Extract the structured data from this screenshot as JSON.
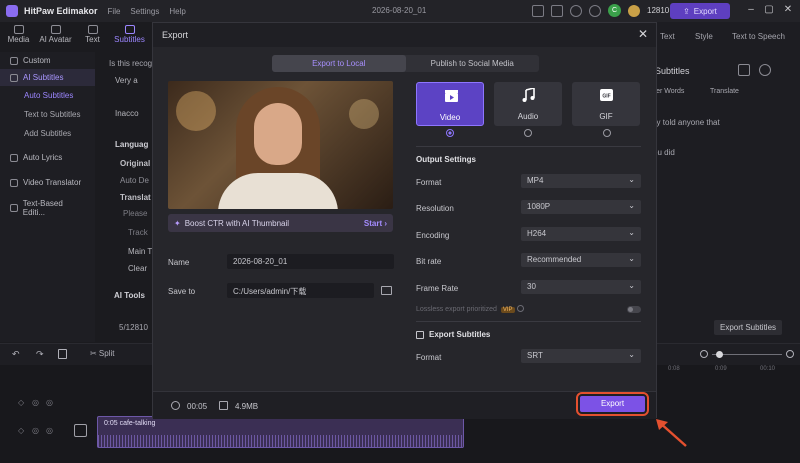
{
  "titlebar": {
    "app_title": "HitPaw Edimakor",
    "menus": [
      "File",
      "Settings",
      "Help"
    ],
    "project_name": "2026-08-20_01",
    "avatar_letter": "C",
    "credits": "12810",
    "export_label": "Export"
  },
  "tool_tabs": [
    {
      "label": "Media",
      "icon": "media-icon"
    },
    {
      "label": "AI Avatar",
      "icon": "avatar-icon"
    },
    {
      "label": "Text",
      "icon": "text-icon"
    },
    {
      "label": "Subtitles",
      "icon": "subtitles-icon"
    }
  ],
  "sidebar": {
    "items": [
      {
        "label": "Custom"
      },
      {
        "label": "AI Subtitles"
      },
      {
        "label": "Auto Subtitles"
      },
      {
        "label": "Text to Subtitles"
      },
      {
        "label": "Add Subtitles"
      },
      {
        "label": "Auto Lyrics"
      },
      {
        "label": "Video Translator"
      },
      {
        "label": "Text-Based Editi..."
      }
    ]
  },
  "mid_panel": {
    "question": "Is this recog",
    "very": "Very a",
    "inacc": "Inacco",
    "language": "Languag",
    "original": "Original",
    "auto": "Auto De",
    "translate": "Translat",
    "please": "Please",
    "track": "Track",
    "main": "Main T",
    "clear": "Clear",
    "ai_tools": "AI Tools",
    "credits_row": "5/12810"
  },
  "right_panel": {
    "tabs": [
      "Text",
      "Style",
      "Text to Speech"
    ],
    "subtitles_label": "Subtitles",
    "filler_words": "ller Words",
    "translate": "Translate",
    "line1": "lly told anyone that",
    "line2": "ou did",
    "export_subtitles_btn": "Export Subtitles"
  },
  "timeline": {
    "clip_label": "0:05 cafe-talking",
    "ruler": [
      "0:08",
      "0:09",
      "00:10"
    ]
  },
  "modal": {
    "title": "Export",
    "tabs": [
      "Export to Local",
      "Publish to Social Media"
    ],
    "boost_text": "Boost CTR with AI Thumbnail",
    "boost_action": "Start",
    "name_label": "Name",
    "name_value": "2026-08-20_01",
    "saveto_label": "Save to",
    "saveto_value": "C:/Users/admin/下载",
    "formats": [
      {
        "label": "Video",
        "icon": "video-clapper-icon",
        "selected": true
      },
      {
        "label": "Audio",
        "icon": "music-note-icon",
        "selected": false
      },
      {
        "label": "GIF",
        "icon": "gif-icon",
        "selected": false
      }
    ],
    "output_settings_title": "Output Settings",
    "settings": [
      {
        "label": "Format",
        "value": "MP4"
      },
      {
        "label": "Resolution",
        "value": "1080P"
      },
      {
        "label": "Encoding",
        "value": "H264"
      },
      {
        "label": "Bit rate",
        "value": "Recommended"
      },
      {
        "label": "Frame Rate",
        "value": "30"
      }
    ],
    "lossless_label": "Lossless export prioritized",
    "vip_badge": "VIP",
    "export_subtitles_label": "Export Subtitles",
    "subtitle_format_label": "Format",
    "subtitle_format_value": "SRT",
    "duration": "00:05",
    "file_size": "4.9MB",
    "export_button": "Export"
  },
  "colors": {
    "accent": "#7c52e6",
    "highlight_box": "#e4502f"
  }
}
